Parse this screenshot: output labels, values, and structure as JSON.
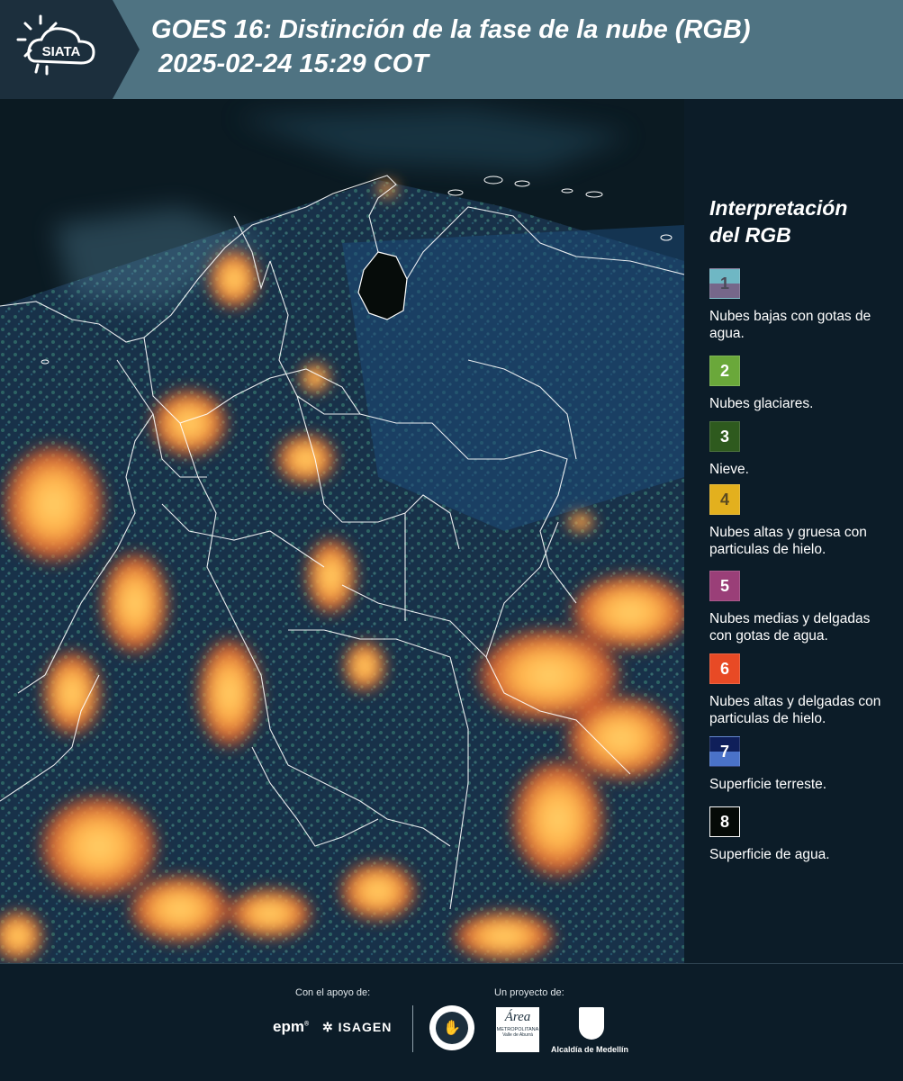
{
  "header": {
    "logo_text": "SIATA",
    "title_line1": "GOES 16: Distinción de la fase de la nube (RGB)",
    "title_line2": "2025-02-24 15:29 COT"
  },
  "legend": {
    "title_line1": "Interpretación",
    "title_line2": "del RGB",
    "items": [
      {
        "number": "1",
        "label": "Nubes bajas con gotas de agua.",
        "color_top": "#6fb7c4",
        "color_bottom": "#76678a"
      },
      {
        "number": "2",
        "label": "Nubes glaciares.",
        "color_top": "#6aa83a",
        "color_bottom": "#6aa83a"
      },
      {
        "number": "3",
        "label": "Nieve.",
        "color_top": "#2e5a1e",
        "color_bottom": "#2e5a1e"
      },
      {
        "number": "4",
        "label": "Nubes altas y gruesa con particulas de hielo.",
        "color_top": "#e3b01e",
        "color_bottom": "#e3b01e"
      },
      {
        "number": "5",
        "label": "Nubes medias y delgadas con gotas de agua.",
        "color_top": "#9a3f78",
        "color_bottom": "#9a3f78"
      },
      {
        "number": "6",
        "label": "Nubes altas y delgadas con particulas de hielo.",
        "color_top": "#e84a25",
        "color_bottom": "#e84a25"
      },
      {
        "number": "7",
        "label": "Superficie terreste.",
        "color_top": "#0f1f5a",
        "color_bottom": "#4a72c8"
      },
      {
        "number": "8",
        "label": "Superficie de agua.",
        "color_top": "#050a07",
        "color_bottom": "#050a07"
      }
    ]
  },
  "footer": {
    "support_label": "Con el apoyo de:",
    "project_label": "Un proyecto de:",
    "sponsor_epm": "epm",
    "sponsor_isagen": "ISAGEN",
    "partner_metro_line1": "Área",
    "partner_metro_line2": "METROPOLITANA",
    "partner_metro_line3": "Valle de Aburrá",
    "partner_alcaldia": "Alcaldía de Medellín"
  },
  "colors": {
    "header_bg": "#4f7382",
    "logo_bg": "#1c2f3d",
    "page_bg": "#0c1c28"
  }
}
